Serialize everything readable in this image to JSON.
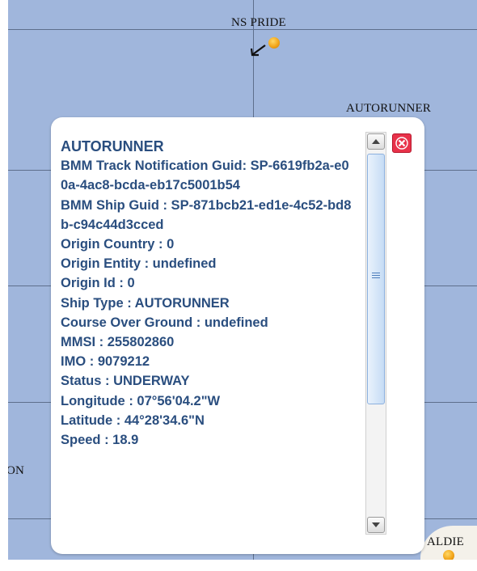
{
  "map": {
    "labels": {
      "ns_pride": "NS PRIDE",
      "autorunner": "AUTORUNNER",
      "left_partial": "ON",
      "bottom_right_partial": "ALDIE"
    }
  },
  "popup": {
    "title": "AUTORUNNER",
    "lines": [
      "BMM Track Notification Guid: SP-6619fb2a-e00a-4ac8-bcda-eb17c5001b54",
      "BMM Ship Guid : SP-871bcb21-ed1e-4c52-bd8b-c94c44d3cced",
      "Origin Country : 0",
      "Origin Entity : undefined",
      "Origin Id : 0",
      "Ship Type : AUTORUNNER",
      "Course Over Ground : undefined",
      "MMSI : 255802860",
      "IMO : 9079212",
      "Status : UNDERWAY",
      "Longitude : 07°56'04.2\"W",
      "Latitude : 44°28'34.6\"N",
      "Speed : 18.9"
    ]
  },
  "colors": {
    "map_water": "#a0b6dc",
    "grid_line": "#5e6f8c",
    "popup_text": "#2a4e7f",
    "close_button": "#e8324a"
  },
  "icons": {
    "close": "close-icon",
    "scroll_up": "arrow-up-icon",
    "scroll_down": "arrow-down-icon",
    "ship_marker": "ship-marker-icon",
    "heading_arrow": "heading-arrow-icon"
  }
}
